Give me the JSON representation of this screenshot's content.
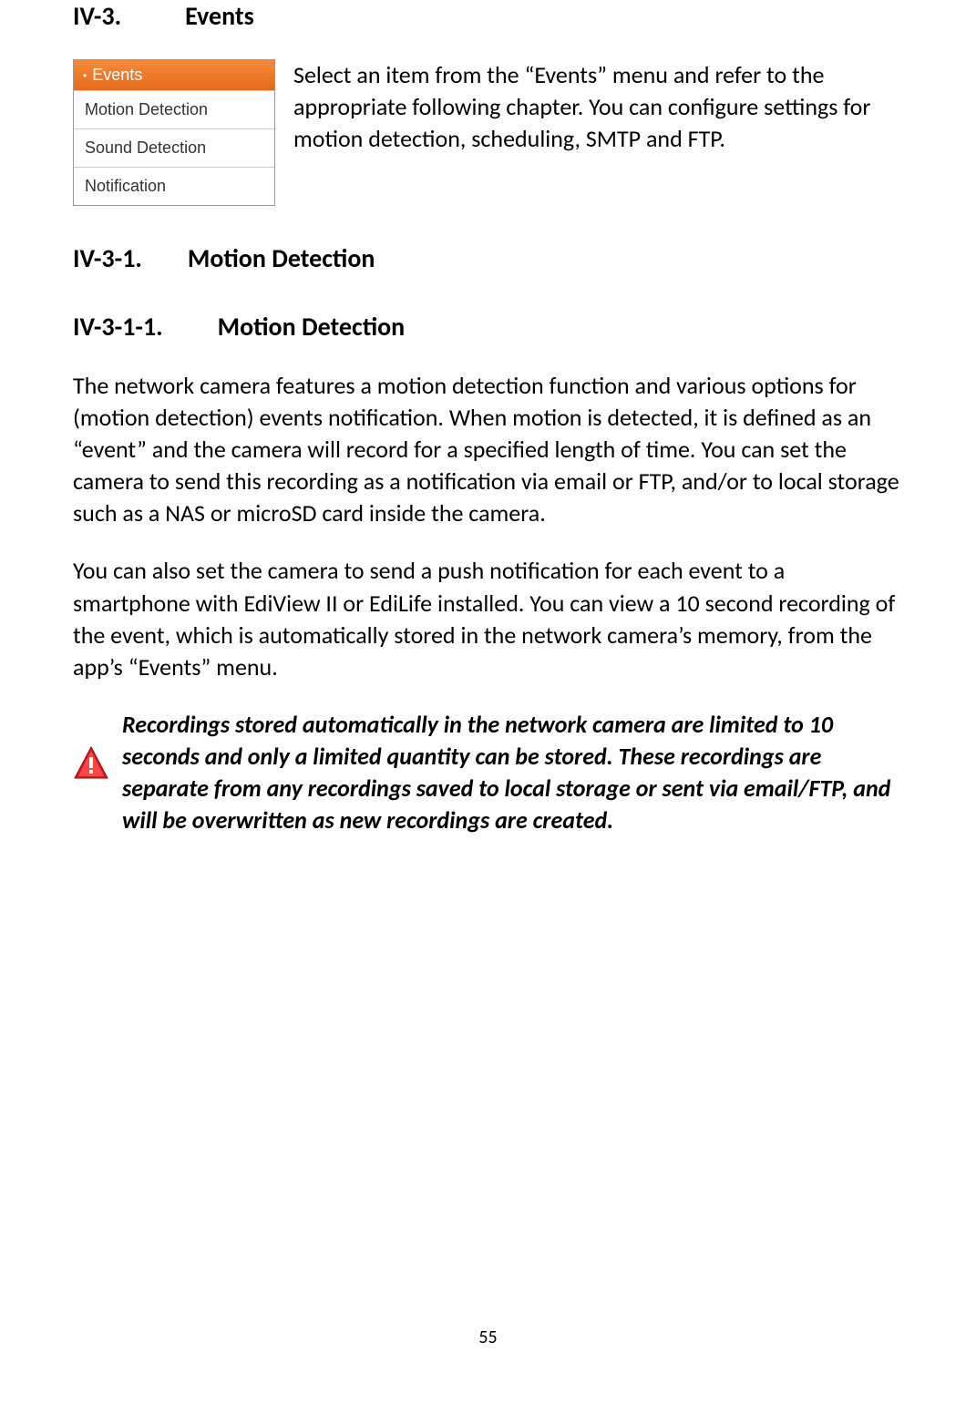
{
  "headings": {
    "h1_num": "IV-3.",
    "h1_title": "Events",
    "h2_num": "IV-3-1.",
    "h2_title": "Motion Detection",
    "h3_num": "IV-3-1-1.",
    "h3_title": "Motion Detection"
  },
  "menu": {
    "header": "Events",
    "items": [
      "Motion Detection",
      "Sound Detection",
      "Notification"
    ]
  },
  "intro_text": "Select an item from the “Events” menu and refer to the appropriate following chapter. You can configure settings for motion detection, scheduling, SMTP and FTP.",
  "paragraphs": {
    "p1": "The network camera features a motion detection function and various options for (motion detection) events notification. When motion is detected, it is defined as an “event” and the camera will record for a specified length of time. You can set the camera to send this recording as a notification via email or FTP, and/or to local storage such as a NAS or microSD card inside the camera.",
    "p2": "You can also set the camera to send a push notification for each event to a smartphone with EdiView II or EdiLife installed. You can view a 10 second recording of the event, which is automatically stored in the network camera’s memory, from the app’s “Events” menu."
  },
  "note": "Recordings stored automatically in the network camera are limited to 10 seconds and only a limited quantity can be stored. These recordings are separate from any recordings saved to local storage or sent via email/FTP, and will be overwritten as new recordings are created.",
  "page_number": "55"
}
